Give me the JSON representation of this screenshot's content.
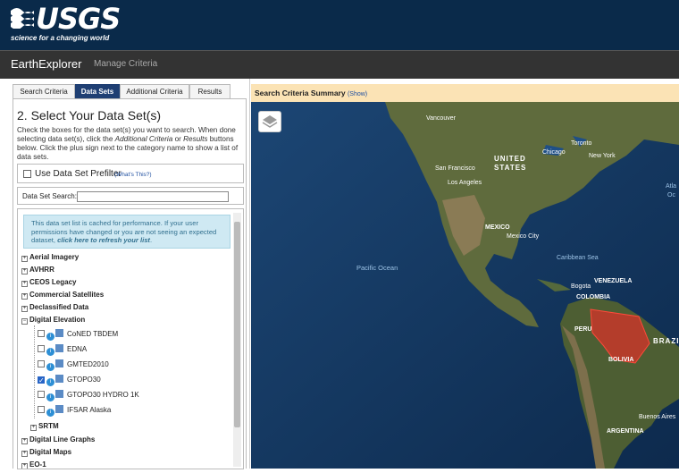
{
  "header": {
    "logo_text": "USGS",
    "tagline": "science for a changing world"
  },
  "navbar": {
    "brand": "EarthExplorer",
    "manage": "Manage Criteria"
  },
  "tabs": [
    "Search Criteria",
    "Data Sets",
    "Additional Criteria",
    "Results"
  ],
  "panel": {
    "title": "2. Select Your Data Set(s)",
    "help_1": "Check the boxes for the data set(s) you want to search. When done selecting data set(s), click the ",
    "help_em1": "Additional Criteria",
    "help_2": " or ",
    "help_em2": "Results",
    "help_3": " buttons below. Click the plus sign next to the category name to show a list of data sets.",
    "prefilter_label": "Use Data Set Prefilter",
    "prefilter_help": "(What's This?)",
    "search_label": "Data Set Search:",
    "search_value": "",
    "notice_1": "This data set list is cached for performance. If your user permissions have changed or you are not seeing an expected dataset, ",
    "notice_link": "click here to refresh your list",
    "notice_2": "."
  },
  "categories_top": [
    "Aerial Imagery",
    "AVHRR",
    "CEOS Legacy",
    "Commercial Satellites",
    "Declassified Data",
    "Digital Elevation"
  ],
  "elevation_datasets": [
    {
      "name": "CoNED TBDEM",
      "checked": false
    },
    {
      "name": "EDNA",
      "checked": false
    },
    {
      "name": "GMTED2010",
      "checked": false
    },
    {
      "name": "GTOPO30",
      "checked": true
    },
    {
      "name": "GTOPO30 HYDRO 1K",
      "checked": false
    },
    {
      "name": "IFSAR Alaska",
      "checked": false
    }
  ],
  "subcategory": "SRTM",
  "categories_bottom": [
    "Digital Line Graphs",
    "Digital Maps",
    "EO-1"
  ],
  "summary": {
    "title": "Search Criteria Summary",
    "show": "(Show)"
  },
  "map_labels": [
    {
      "text": "Vancouver",
      "kind": "city"
    },
    {
      "text": "Toronto",
      "kind": "city"
    },
    {
      "text": "Chicago",
      "kind": "city"
    },
    {
      "text": "New York",
      "kind": "city"
    },
    {
      "text": "UNITED",
      "kind": "country"
    },
    {
      "text": "STATES",
      "kind": "country"
    },
    {
      "text": "San Francisco",
      "kind": "city"
    },
    {
      "text": "Los Angeles",
      "kind": "city"
    },
    {
      "text": "MEXICO",
      "kind": "country"
    },
    {
      "text": "Mexico City",
      "kind": "city"
    },
    {
      "text": "Pacific Ocean",
      "kind": "ocean"
    },
    {
      "text": "Caribbean Sea",
      "kind": "ocean"
    },
    {
      "text": "VENEZUELA",
      "kind": "country"
    },
    {
      "text": "Bogota",
      "kind": "city"
    },
    {
      "text": "COLOMBIA",
      "kind": "country"
    },
    {
      "text": "PERU",
      "kind": "country"
    },
    {
      "text": "BRAZIL",
      "kind": "country"
    },
    {
      "text": "BOLIVIA",
      "kind": "country"
    },
    {
      "text": "Buenos Aires",
      "kind": "city"
    },
    {
      "text": "ARGENTINA",
      "kind": "country"
    },
    {
      "text": "Atla",
      "kind": "ocean"
    },
    {
      "text": "Oc",
      "kind": "ocean"
    }
  ],
  "colors": {
    "header": "#0a2a4a",
    "active_tab": "#1f3f73",
    "summary": "#fbe3b5",
    "ocean": "#12355f",
    "land": "#5f6b3d",
    "aoi": "#d7332a"
  }
}
